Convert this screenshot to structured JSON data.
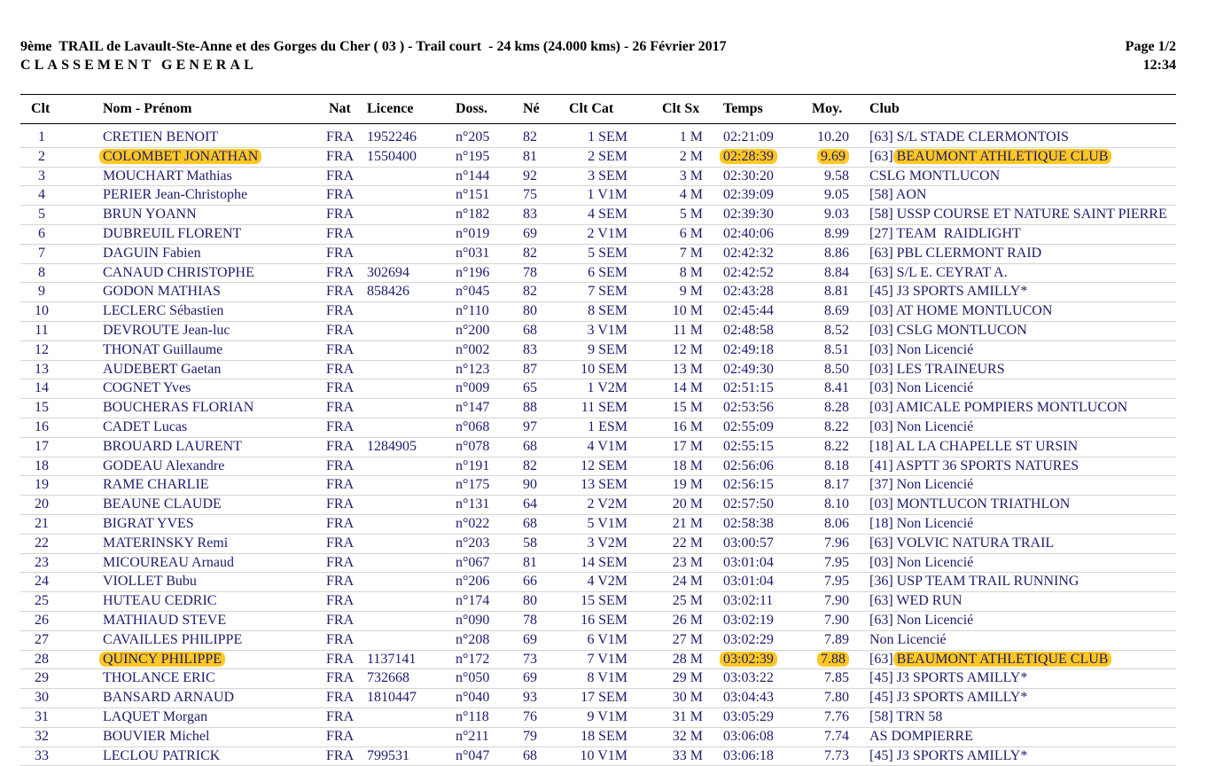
{
  "header": {
    "title": "9ème  TRAIL de Lavault-Ste-Anne et des Gorges du Cher ( 03 ) - Trail court  - 24 kms (24.000 kms) - 26 Février 2017",
    "subtitle": "CLASSEMENT GENERAL",
    "page": "Page 1/2",
    "time": "12:34"
  },
  "columns": {
    "clt": "Clt",
    "nom": "Nom - Prénom",
    "nat": "Nat",
    "licence": "Licence",
    "doss": "Doss.",
    "ne": "Né",
    "cltcat": "Clt Cat",
    "cltsx": "Clt Sx",
    "temps": "Temps",
    "moy": "Moy.",
    "club": "Club"
  },
  "highlight_color": "#ffc724",
  "rows": [
    {
      "clt": "1",
      "nom": "CRETIEN BENOIT",
      "nat": "FRA",
      "licence": "1952246",
      "doss": "n°205",
      "ne": "82",
      "cat": "1 SEM",
      "sx": "1 M",
      "temps": "02:21:09",
      "moy": "10.20",
      "club_prefix": "[63] ",
      "club": "S/L STADE CLERMONTOIS",
      "hl": false
    },
    {
      "clt": "2",
      "nom": "COLOMBET JONATHAN",
      "nat": "FRA",
      "licence": "1550400",
      "doss": "n°195",
      "ne": "81",
      "cat": "2 SEM",
      "sx": "2 M",
      "temps": "02:28:39",
      "moy": "9.69",
      "club_prefix": "[63] ",
      "club": "BEAUMONT ATHLETIQUE CLUB",
      "hl": true
    },
    {
      "clt": "3",
      "nom": "MOUCHART Mathias",
      "nat": "FRA",
      "licence": "",
      "doss": "n°144",
      "ne": "92",
      "cat": "3 SEM",
      "sx": "3 M",
      "temps": "02:30:20",
      "moy": "9.58",
      "club_prefix": "",
      "club": "CSLG MONTLUCON",
      "hl": false
    },
    {
      "clt": "4",
      "nom": "PERIER Jean-Christophe",
      "nat": "FRA",
      "licence": "",
      "doss": "n°151",
      "ne": "75",
      "cat": "1 V1M",
      "sx": "4 M",
      "temps": "02:39:09",
      "moy": "9.05",
      "club_prefix": "[58] ",
      "club": "AON",
      "hl": false
    },
    {
      "clt": "5",
      "nom": "BRUN YOANN",
      "nat": "FRA",
      "licence": "",
      "doss": "n°182",
      "ne": "83",
      "cat": "4 SEM",
      "sx": "5 M",
      "temps": "02:39:30",
      "moy": "9.03",
      "club_prefix": "[58] ",
      "club": "USSP COURSE ET NATURE SAINT PIERRE",
      "hl": false
    },
    {
      "clt": "6",
      "nom": "DUBREUIL FLORENT",
      "nat": "FRA",
      "licence": "",
      "doss": "n°019",
      "ne": "69",
      "cat": "2 V1M",
      "sx": "6 M",
      "temps": "02:40:06",
      "moy": "8.99",
      "club_prefix": "[27] ",
      "club": "TEAM  RAIDLIGHT",
      "hl": false
    },
    {
      "clt": "7",
      "nom": "DAGUIN Fabien",
      "nat": "FRA",
      "licence": "",
      "doss": "n°031",
      "ne": "82",
      "cat": "5 SEM",
      "sx": "7 M",
      "temps": "02:42:32",
      "moy": "8.86",
      "club_prefix": "[63] ",
      "club": "PBL CLERMONT RAID",
      "hl": false
    },
    {
      "clt": "8",
      "nom": "CANAUD CHRISTOPHE",
      "nat": "FRA",
      "licence": "302694",
      "doss": "n°196",
      "ne": "78",
      "cat": "6 SEM",
      "sx": "8 M",
      "temps": "02:42:52",
      "moy": "8.84",
      "club_prefix": "[63] ",
      "club": "S/L E. CEYRAT A.",
      "hl": false
    },
    {
      "clt": "9",
      "nom": "GODON MATHIAS",
      "nat": "FRA",
      "licence": "858426",
      "doss": "n°045",
      "ne": "82",
      "cat": "7 SEM",
      "sx": "9 M",
      "temps": "02:43:28",
      "moy": "8.81",
      "club_prefix": "[45] ",
      "club": "J3 SPORTS AMILLY*",
      "hl": false
    },
    {
      "clt": "10",
      "nom": "LECLERC Sébastien",
      "nat": "FRA",
      "licence": "",
      "doss": "n°110",
      "ne": "80",
      "cat": "8 SEM",
      "sx": "10 M",
      "temps": "02:45:44",
      "moy": "8.69",
      "club_prefix": "[03] ",
      "club": "AT HOME MONTLUCON",
      "hl": false
    },
    {
      "clt": "11",
      "nom": "DEVROUTE Jean-luc",
      "nat": "FRA",
      "licence": "",
      "doss": "n°200",
      "ne": "68",
      "cat": "3 V1M",
      "sx": "11 M",
      "temps": "02:48:58",
      "moy": "8.52",
      "club_prefix": "[03] ",
      "club": "CSLG MONTLUCON",
      "hl": false
    },
    {
      "clt": "12",
      "nom": "THONAT Guillaume",
      "nat": "FRA",
      "licence": "",
      "doss": "n°002",
      "ne": "83",
      "cat": "9 SEM",
      "sx": "12 M",
      "temps": "02:49:18",
      "moy": "8.51",
      "club_prefix": "[03] ",
      "club": "Non Licencié",
      "hl": false
    },
    {
      "clt": "13",
      "nom": "AUDEBERT Gaetan",
      "nat": "FRA",
      "licence": "",
      "doss": "n°123",
      "ne": "87",
      "cat": "10 SEM",
      "sx": "13 M",
      "temps": "02:49:30",
      "moy": "8.50",
      "club_prefix": "[03] ",
      "club": "LES TRAINEURS",
      "hl": false
    },
    {
      "clt": "14",
      "nom": "COGNET Yves",
      "nat": "FRA",
      "licence": "",
      "doss": "n°009",
      "ne": "65",
      "cat": "1 V2M",
      "sx": "14 M",
      "temps": "02:51:15",
      "moy": "8.41",
      "club_prefix": "[03] ",
      "club": "Non Licencié",
      "hl": false
    },
    {
      "clt": "15",
      "nom": "BOUCHERAS FLORIAN",
      "nat": "FRA",
      "licence": "",
      "doss": "n°147",
      "ne": "88",
      "cat": "11 SEM",
      "sx": "15 M",
      "temps": "02:53:56",
      "moy": "8.28",
      "club_prefix": "[03] ",
      "club": "AMICALE POMPIERS MONTLUCON",
      "hl": false
    },
    {
      "clt": "16",
      "nom": "CADET Lucas",
      "nat": "FRA",
      "licence": "",
      "doss": "n°068",
      "ne": "97",
      "cat": "1 ESM",
      "sx": "16 M",
      "temps": "02:55:09",
      "moy": "8.22",
      "club_prefix": "[03] ",
      "club": "Non Licencié",
      "hl": false
    },
    {
      "clt": "17",
      "nom": "BROUARD LAURENT",
      "nat": "FRA",
      "licence": "1284905",
      "doss": "n°078",
      "ne": "68",
      "cat": "4 V1M",
      "sx": "17 M",
      "temps": "02:55:15",
      "moy": "8.22",
      "club_prefix": "[18] ",
      "club": "AL LA CHAPELLE ST URSIN",
      "hl": false
    },
    {
      "clt": "18",
      "nom": "GODEAU Alexandre",
      "nat": "FRA",
      "licence": "",
      "doss": "n°191",
      "ne": "82",
      "cat": "12 SEM",
      "sx": "18 M",
      "temps": "02:56:06",
      "moy": "8.18",
      "club_prefix": "[41] ",
      "club": "ASPTT 36 SPORTS NATURES",
      "hl": false
    },
    {
      "clt": "19",
      "nom": "RAME CHARLIE",
      "nat": "FRA",
      "licence": "",
      "doss": "n°175",
      "ne": "90",
      "cat": "13 SEM",
      "sx": "19 M",
      "temps": "02:56:15",
      "moy": "8.17",
      "club_prefix": "[37] ",
      "club": "Non Licencié",
      "hl": false
    },
    {
      "clt": "20",
      "nom": "BEAUNE CLAUDE",
      "nat": "FRA",
      "licence": "",
      "doss": "n°131",
      "ne": "64",
      "cat": "2 V2M",
      "sx": "20 M",
      "temps": "02:57:50",
      "moy": "8.10",
      "club_prefix": "[03] ",
      "club": "MONTLUCON TRIATHLON",
      "hl": false
    },
    {
      "clt": "21",
      "nom": "BIGRAT YVES",
      "nat": "FRA",
      "licence": "",
      "doss": "n°022",
      "ne": "68",
      "cat": "5 V1M",
      "sx": "21 M",
      "temps": "02:58:38",
      "moy": "8.06",
      "club_prefix": "[18] ",
      "club": "Non Licencié",
      "hl": false
    },
    {
      "clt": "22",
      "nom": "MATERINSKY Remi",
      "nat": "FRA",
      "licence": "",
      "doss": "n°203",
      "ne": "58",
      "cat": "3 V2M",
      "sx": "22 M",
      "temps": "03:00:57",
      "moy": "7.96",
      "club_prefix": "[63] ",
      "club": "VOLVIC NATURA TRAIL",
      "hl": false
    },
    {
      "clt": "23",
      "nom": "MICOUREAU Arnaud",
      "nat": "FRA",
      "licence": "",
      "doss": "n°067",
      "ne": "81",
      "cat": "14 SEM",
      "sx": "23 M",
      "temps": "03:01:04",
      "moy": "7.95",
      "club_prefix": "[03] ",
      "club": "Non Licencié",
      "hl": false
    },
    {
      "clt": "24",
      "nom": "VIOLLET Bubu",
      "nat": "FRA",
      "licence": "",
      "doss": "n°206",
      "ne": "66",
      "cat": "4 V2M",
      "sx": "24 M",
      "temps": "03:01:04",
      "moy": "7.95",
      "club_prefix": "[36] ",
      "club": "USP TEAM TRAIL RUNNING",
      "hl": false
    },
    {
      "clt": "25",
      "nom": "HUTEAU CEDRIC",
      "nat": "FRA",
      "licence": "",
      "doss": "n°174",
      "ne": "80",
      "cat": "15 SEM",
      "sx": "25 M",
      "temps": "03:02:11",
      "moy": "7.90",
      "club_prefix": "[63] ",
      "club": "WED RUN",
      "hl": false
    },
    {
      "clt": "26",
      "nom": "MATHIAUD STEVE",
      "nat": "FRA",
      "licence": "",
      "doss": "n°090",
      "ne": "78",
      "cat": "16 SEM",
      "sx": "26 M",
      "temps": "03:02:19",
      "moy": "7.90",
      "club_prefix": "[63] ",
      "club": "Non Licencié",
      "hl": false
    },
    {
      "clt": "27",
      "nom": "CAVAILLES PHILIPPE",
      "nat": "FRA",
      "licence": "",
      "doss": "n°208",
      "ne": "69",
      "cat": "6 V1M",
      "sx": "27 M",
      "temps": "03:02:29",
      "moy": "7.89",
      "club_prefix": "",
      "club": "Non Licencié",
      "hl": false
    },
    {
      "clt": "28",
      "nom": "QUINCY PHILIPPE",
      "nat": "FRA",
      "licence": "1137141",
      "doss": "n°172",
      "ne": "73",
      "cat": "7 V1M",
      "sx": "28 M",
      "temps": "03:02:39",
      "moy": "7.88",
      "club_prefix": "[63] ",
      "club": "BEAUMONT ATHLETIQUE CLUB",
      "hl": true
    },
    {
      "clt": "29",
      "nom": "THOLANCE ERIC",
      "nat": "FRA",
      "licence": "732668",
      "doss": "n°050",
      "ne": "69",
      "cat": "8 V1M",
      "sx": "29 M",
      "temps": "03:03:22",
      "moy": "7.85",
      "club_prefix": "[45] ",
      "club": "J3 SPORTS AMILLY*",
      "hl": false
    },
    {
      "clt": "30",
      "nom": "BANSARD ARNAUD",
      "nat": "FRA",
      "licence": "1810447",
      "doss": "n°040",
      "ne": "93",
      "cat": "17 SEM",
      "sx": "30 M",
      "temps": "03:04:43",
      "moy": "7.80",
      "club_prefix": "[45] ",
      "club": "J3 SPORTS AMILLY*",
      "hl": false
    },
    {
      "clt": "31",
      "nom": "LAQUET Morgan",
      "nat": "FRA",
      "licence": "",
      "doss": "n°118",
      "ne": "76",
      "cat": "9 V1M",
      "sx": "31 M",
      "temps": "03:05:29",
      "moy": "7.76",
      "club_prefix": "[58] ",
      "club": "TRN 58",
      "hl": false
    },
    {
      "clt": "32",
      "nom": "BOUVIER Michel",
      "nat": "FRA",
      "licence": "",
      "doss": "n°211",
      "ne": "79",
      "cat": "18 SEM",
      "sx": "32 M",
      "temps": "03:06:08",
      "moy": "7.74",
      "club_prefix": "",
      "club": "AS DOMPIERRE",
      "hl": false
    },
    {
      "clt": "33",
      "nom": "LECLOU PATRICK",
      "nat": "FRA",
      "licence": "799531",
      "doss": "n°047",
      "ne": "68",
      "cat": "10 V1M",
      "sx": "33 M",
      "temps": "03:06:18",
      "moy": "7.73",
      "club_prefix": "[45] ",
      "club": "J3 SPORTS AMILLY*",
      "hl": false
    }
  ]
}
